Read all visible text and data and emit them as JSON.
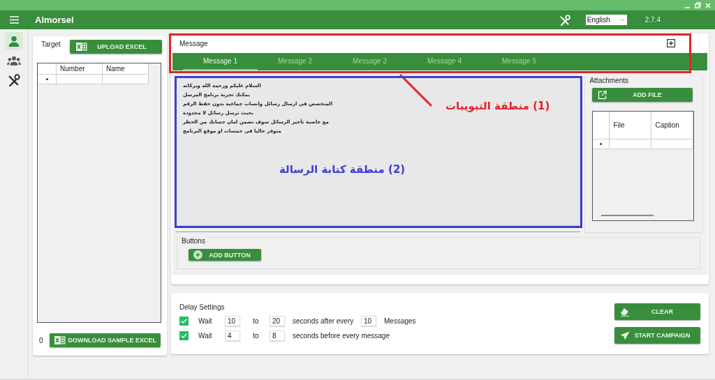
{
  "app_bar": {
    "title": "Almorsel",
    "language": "English",
    "version": "2.7.4"
  },
  "nav": [
    {
      "kind": "person",
      "selected": true
    },
    {
      "kind": "group",
      "selected": false
    },
    {
      "kind": "tools",
      "selected": false
    }
  ],
  "target": {
    "title": "Target",
    "upload_button": "UPLOAD EXCEL",
    "columns": [
      "Number",
      "Name"
    ],
    "count": "0",
    "download_button": "DOWNLOAD SAMPLE EXCEL"
  },
  "message": {
    "title": "Message",
    "tabs": [
      {
        "label": "Message 1",
        "selected": true
      },
      {
        "label": "Message 2",
        "selected": false
      },
      {
        "label": "Message 3",
        "selected": false
      },
      {
        "label": "Message 4",
        "selected": false
      },
      {
        "label": "Message 5",
        "selected": false
      }
    ],
    "text": "السلام عليكم ورحمة الله وبركاته\nيمكنك تجربة برنامج المرسل\nالمتخصص في ارسال رسائل واتساب جماعية بدون حفظ الرقم\nبحيث ترسل رسائل لا محدودة\nمع خاصية تأخير الرسائل سوف تضمن امان حسابك من الحظر\nمتوفر حاليا في خمسات او موقع البرنامج",
    "attachments": {
      "title": "Attachments",
      "button": "ADD FILE",
      "columns": [
        "File",
        "Caption"
      ]
    },
    "buttons": {
      "title": "Buttons",
      "button": "ADD BUTTON"
    }
  },
  "delay": {
    "title": "Delay Settings",
    "rows": [
      {
        "checked": true,
        "label": "Wait",
        "from": "10",
        "to_label": "to",
        "to": "20",
        "text": "seconds after every",
        "count": "10",
        "unit": "Messages"
      },
      {
        "checked": true,
        "label": "Wait",
        "from": "4",
        "to_label": "to",
        "to": "8",
        "text": "seconds before every message"
      }
    ]
  },
  "actions": [
    {
      "kind": "clear",
      "label": "CLEAR"
    },
    {
      "kind": "send",
      "label": "START CAMPAIGN"
    }
  ],
  "annotations": [
    {
      "text": "(1) منطقة التبويبات",
      "color": "#e8202a"
    },
    {
      "text": "(2) منطقة كتابة الرسالة",
      "color": "#3a3fd0"
    }
  ]
}
